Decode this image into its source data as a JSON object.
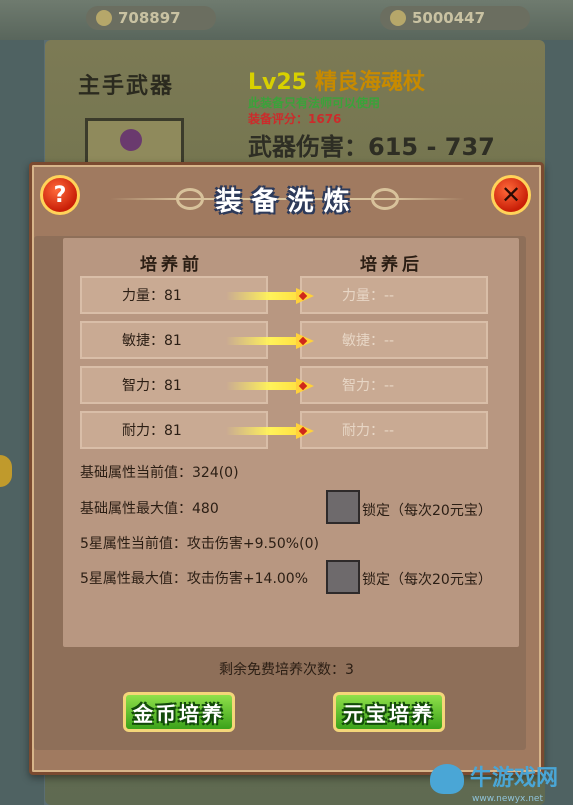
{
  "background": {
    "silver_amount": "708897",
    "gold_amount": "5000447",
    "weapon_slot_label": "主手武器",
    "item_level": "Lv25",
    "item_name": "精良海魂杖",
    "item_note": "此装备只有法师可以使用",
    "item_score": "装备评分：1676",
    "item_damage": "武器伤害：615 - 737"
  },
  "dialog": {
    "title": "装备洗炼",
    "help_label": "?",
    "close_label": "✕",
    "before_header": "培养前",
    "after_header": "培养后",
    "attributes": [
      {
        "before": "力量：81",
        "after": "力量：--"
      },
      {
        "before": "敏捷：81",
        "after": "敏捷：--"
      },
      {
        "before": "智力：81",
        "after": "智力：--"
      },
      {
        "before": "耐力：81",
        "after": "耐力：--"
      }
    ],
    "base_current": "基础属性当前值：324(0)",
    "base_max": "基础属性最大值：480",
    "lock_label_1": "锁定（每次20元宝）",
    "star_current": "5星属性当前值：攻击伤害+9.50%(0)",
    "star_max": "5星属性最大值：攻击伤害+14.00%",
    "lock_label_2": "锁定（每次20元宝）",
    "remaining_free": "剩余免费培养次数：3",
    "gold_train_button": "金币培养",
    "yuanbao_train_button": "元宝培养"
  },
  "watermark": {
    "text": "牛游戏网",
    "url": "www.newyx.net"
  }
}
